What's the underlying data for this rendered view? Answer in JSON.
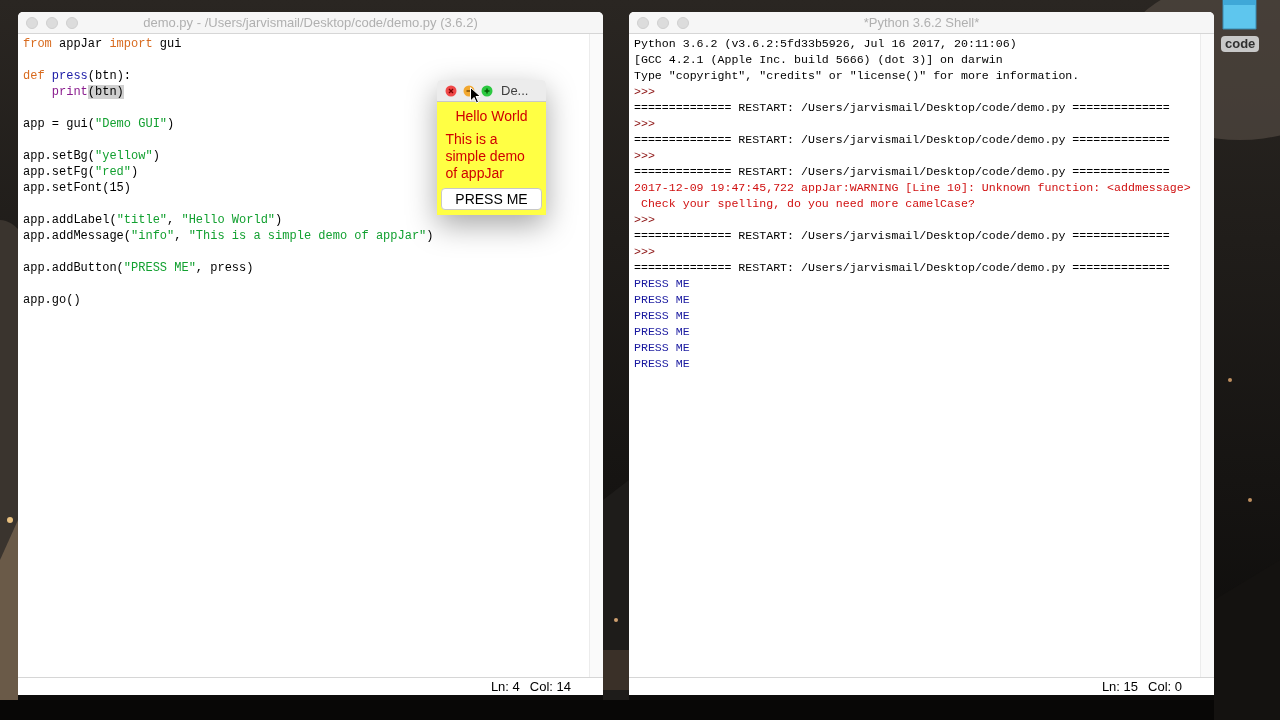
{
  "desktop": {
    "folder": {
      "label": "code"
    }
  },
  "editor": {
    "title": "demo.py - /Users/jarvismail/Desktop/code/demo.py (3.6.2)",
    "blocks": [
      [
        [
          {
            "text": "from",
            "kind": "keyword"
          },
          {
            "text": " appJar ",
            "kind": "plain"
          },
          {
            "text": "import",
            "kind": "keyword"
          },
          {
            "text": " gui",
            "kind": "plain"
          }
        ]
      ],
      [
        [
          {
            "text": "def ",
            "kind": "keyword"
          },
          {
            "text": "press",
            "kind": "defname"
          },
          {
            "text": "(btn):",
            "kind": "plain"
          }
        ],
        [
          {
            "text": "    print",
            "kind": "builtin"
          },
          {
            "text": "(btn)",
            "kind": "highlight"
          }
        ]
      ],
      [
        [
          {
            "text": "app = gui(",
            "kind": "plain"
          },
          {
            "text": "\"Demo GUI\"",
            "kind": "string"
          },
          {
            "text": ")",
            "kind": "plain"
          }
        ]
      ],
      [
        [
          {
            "text": "app.setBg(",
            "kind": "plain"
          },
          {
            "text": "\"yellow\"",
            "kind": "string"
          },
          {
            "text": ")",
            "kind": "plain"
          }
        ],
        [
          {
            "text": "app.setFg(",
            "kind": "plain"
          },
          {
            "text": "\"red\"",
            "kind": "string"
          },
          {
            "text": ")",
            "kind": "plain"
          }
        ],
        [
          {
            "text": "app.setFont(15)",
            "kind": "plain"
          }
        ]
      ],
      [
        [
          {
            "text": "app.addLabel(",
            "kind": "plain"
          },
          {
            "text": "\"title\"",
            "kind": "string"
          },
          {
            "text": ", ",
            "kind": "plain"
          },
          {
            "text": "\"Hello World\"",
            "kind": "string"
          },
          {
            "text": ")",
            "kind": "plain"
          }
        ],
        [
          {
            "text": "app.addMessage(",
            "kind": "plain"
          },
          {
            "text": "\"info\"",
            "kind": "string"
          },
          {
            "text": ", ",
            "kind": "plain"
          },
          {
            "text": "\"This is a simple demo of appJar\"",
            "kind": "string"
          },
          {
            "text": ")",
            "kind": "plain"
          }
        ]
      ],
      [
        [
          {
            "text": "app.addButton(",
            "kind": "plain"
          },
          {
            "text": "\"PRESS ME\"",
            "kind": "string"
          },
          {
            "text": ", press)",
            "kind": "plain"
          }
        ]
      ],
      [
        [
          {
            "text": "app.go()",
            "kind": "plain"
          }
        ]
      ]
    ],
    "status": {
      "line": "Ln: 4",
      "col": "Col: 14"
    }
  },
  "shell": {
    "title": "*Python 3.6.2 Shell*",
    "lines": [
      {
        "text": "Python 3.6.2 (v3.6.2:5fd33b5926, Jul 16 2017, 20:11:06)",
        "kind": "plain"
      },
      {
        "text": "[GCC 4.2.1 (Apple Inc. build 5666) (dot 3)] on darwin",
        "kind": "plain"
      },
      {
        "text": "Type \"copyright\", \"credits\" or \"license()\" for more information.",
        "kind": "plain"
      },
      {
        "text": ">>>",
        "kind": "prompt"
      },
      {
        "text": "============== RESTART: /Users/jarvismail/Desktop/code/demo.py ==============",
        "kind": "plain"
      },
      {
        "text": ">>>",
        "kind": "prompt"
      },
      {
        "text": "============== RESTART: /Users/jarvismail/Desktop/code/demo.py ==============",
        "kind": "plain"
      },
      {
        "text": ">>>",
        "kind": "prompt"
      },
      {
        "text": "============== RESTART: /Users/jarvismail/Desktop/code/demo.py ==============",
        "kind": "plain"
      },
      {
        "text": "2017-12-09 19:47:45,722 appJar:WARNING [Line 10]: Unknown function: <addmessage>",
        "kind": "error"
      },
      {
        "text": " Check your spelling, do you need more camelCase?",
        "kind": "error"
      },
      {
        "text": ">>>",
        "kind": "prompt"
      },
      {
        "text": "============== RESTART: /Users/jarvismail/Desktop/code/demo.py ==============",
        "kind": "plain"
      },
      {
        "text": ">>>",
        "kind": "prompt"
      },
      {
        "text": "============== RESTART: /Users/jarvismail/Desktop/code/demo.py ==============",
        "kind": "plain"
      },
      {
        "text": "PRESS ME",
        "kind": "output"
      },
      {
        "text": "PRESS ME",
        "kind": "output"
      },
      {
        "text": "PRESS ME",
        "kind": "output"
      },
      {
        "text": "PRESS ME",
        "kind": "output"
      },
      {
        "text": "PRESS ME",
        "kind": "output"
      },
      {
        "text": "PRESS ME",
        "kind": "output"
      }
    ],
    "status": {
      "line": "Ln: 15",
      "col": "Col: 0"
    }
  },
  "popup": {
    "title": "De...",
    "label": "Hello World",
    "message": "This is a simple demo of appJar",
    "button": "PRESS ME"
  }
}
